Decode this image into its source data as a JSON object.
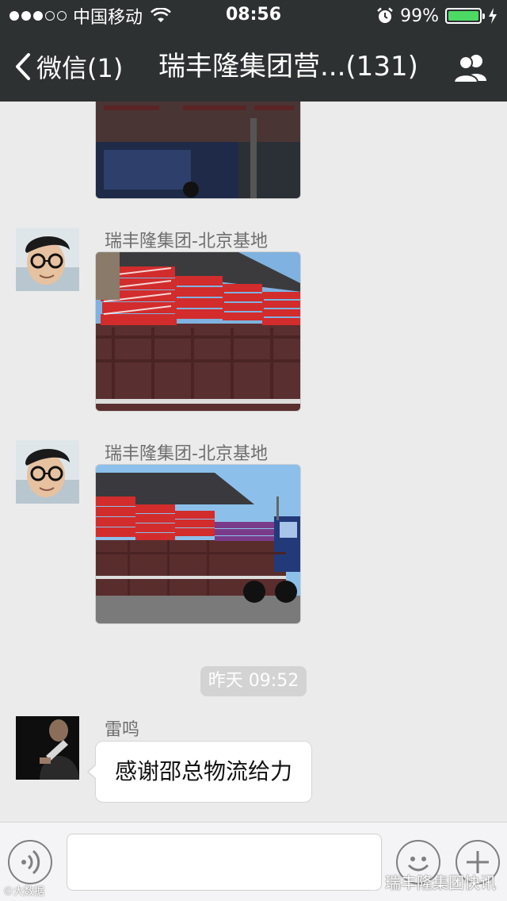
{
  "status_bar": {
    "carrier": "中国移动",
    "time": "08:56",
    "battery_percent": "99%",
    "battery_level": 0.99,
    "signal_bars_filled": 3,
    "signal_bars_total": 5
  },
  "nav": {
    "back_label": "微信(1)",
    "title": "瑞丰隆集团营...(131)"
  },
  "messages": [
    {
      "type": "image",
      "sender": "",
      "description_icon": "truck-photo-icon"
    },
    {
      "type": "image",
      "sender": "瑞丰隆集团-北京基地",
      "description_icon": "truck-photo-icon"
    },
    {
      "type": "image",
      "sender": "瑞丰隆集团-北京基地",
      "description_icon": "truck-photo-icon"
    },
    {
      "type": "timestamp",
      "text": "昨天 09:52"
    },
    {
      "type": "text",
      "sender": "雷鸣",
      "text": "感谢邵总物流给力"
    }
  ],
  "watermark": {
    "text": "瑞丰隆集团快讯",
    "small_text": "©大数据"
  },
  "colors": {
    "header_bg": "#2e3132",
    "chat_bg": "#ebebeb",
    "battery_green": "#4cd964",
    "timestamp_bg": "#d3d3d3"
  }
}
